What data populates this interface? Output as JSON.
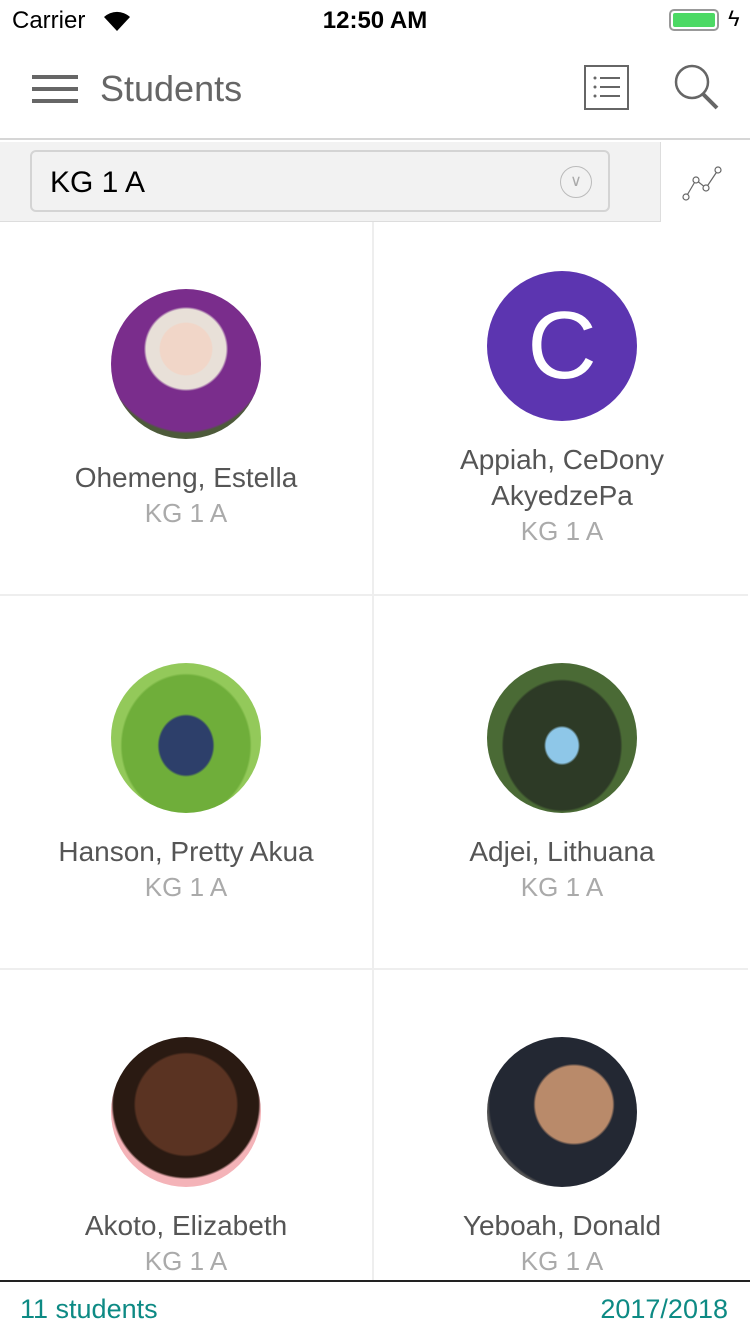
{
  "status": {
    "carrier": "Carrier",
    "time": "12:50 AM"
  },
  "header": {
    "title": "Students"
  },
  "filter": {
    "selected": "KG 1 A"
  },
  "students": [
    {
      "name": "Ohemeng, Estella",
      "class": "KG 1 A",
      "avatar": "photo"
    },
    {
      "name": "Appiah, CeDony AkyedzePa",
      "class": "KG 1 A",
      "avatar": "initial",
      "initial": "C",
      "color": "#5c35b0"
    },
    {
      "name": "Hanson, Pretty Akua",
      "class": "KG 1 A",
      "avatar": "photo"
    },
    {
      "name": "Adjei, Lithuana",
      "class": "KG 1 A",
      "avatar": "photo"
    },
    {
      "name": "Akoto, Elizabeth",
      "class": "KG 1 A",
      "avatar": "photo"
    },
    {
      "name": "Yeboah, Donald",
      "class": "KG 1 A",
      "avatar": "photo"
    }
  ],
  "footer": {
    "count": "11 students",
    "year": "2017/2018"
  },
  "colors": {
    "accent": "#0d8a84",
    "battery": "#4cd964"
  }
}
